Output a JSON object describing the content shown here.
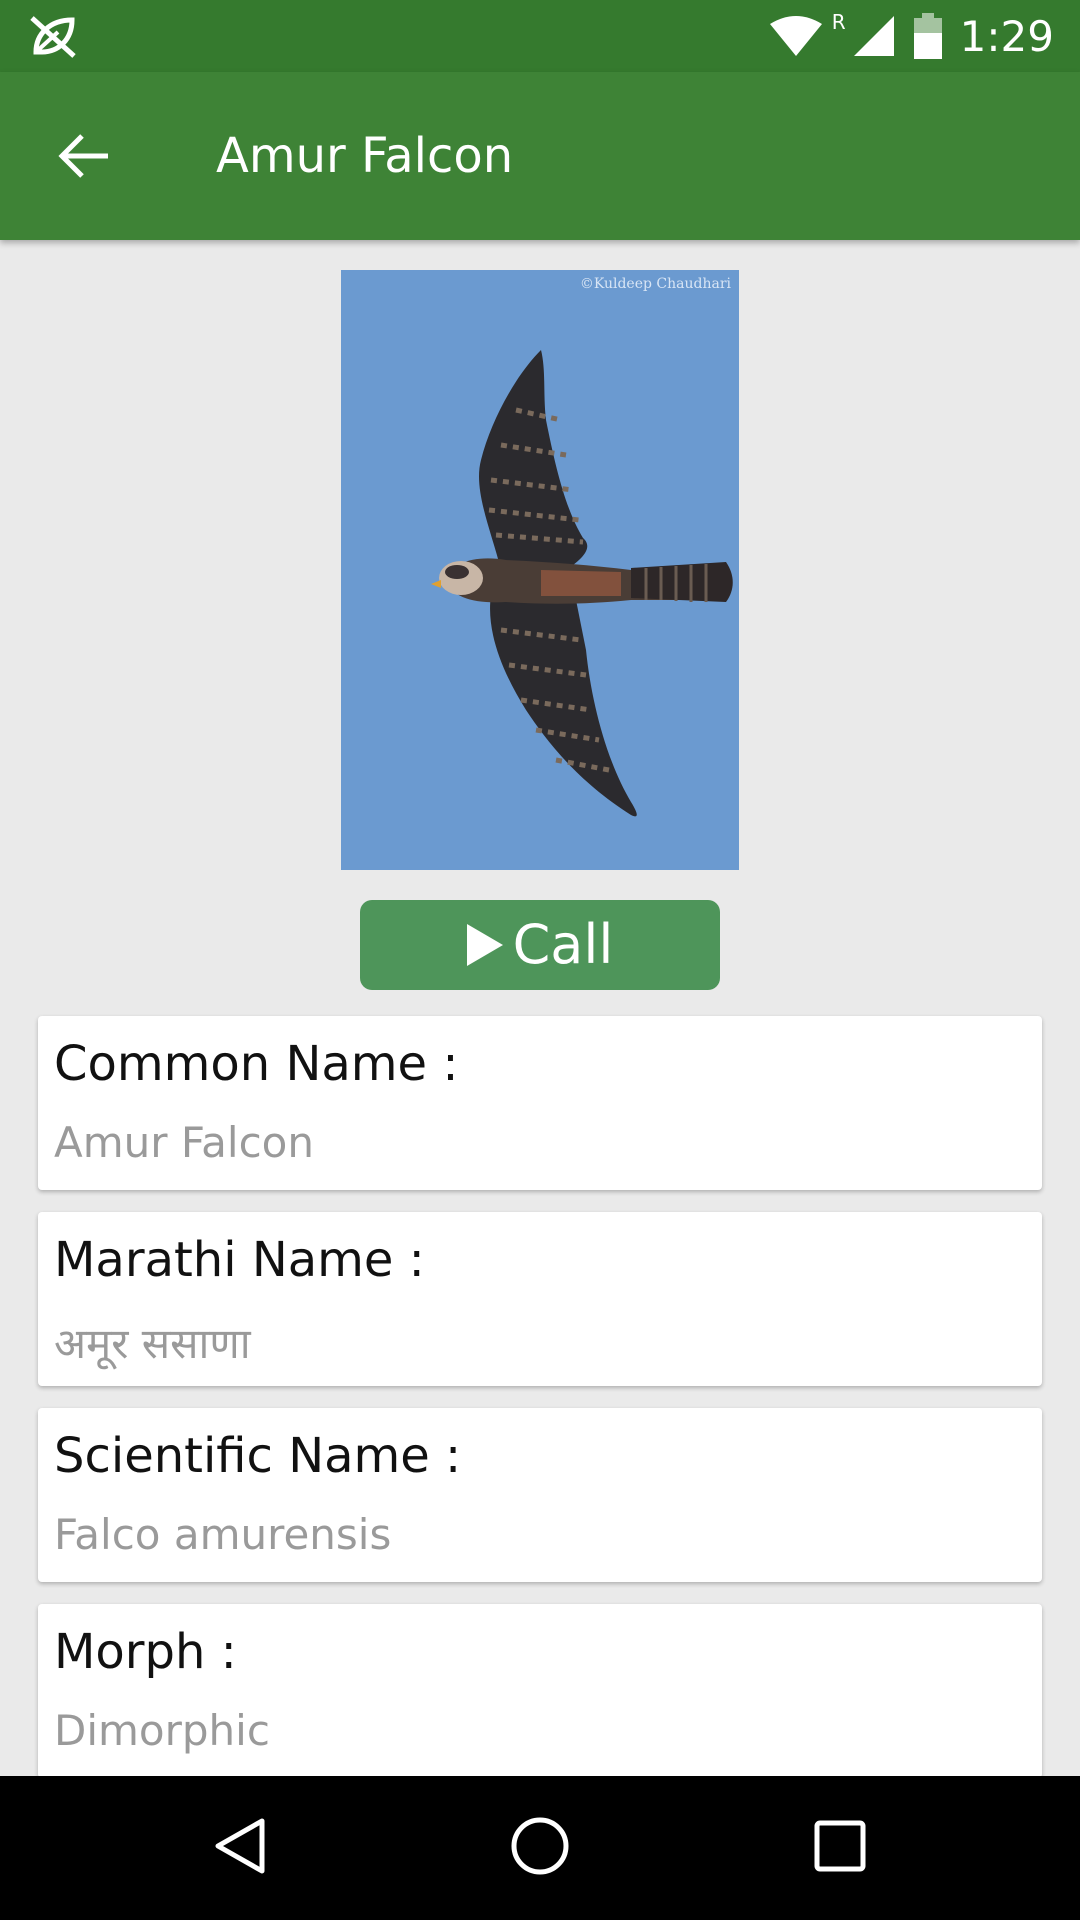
{
  "status_bar": {
    "time": "1:29",
    "left_icon": "no-sync-icon",
    "wifi_icon": "wifi-icon",
    "roaming_indicator": "R",
    "signal_icon": "cell-signal-icon",
    "battery_icon": "battery-icon"
  },
  "app_bar": {
    "title": "Amur Falcon",
    "back_icon": "arrow-back-icon"
  },
  "photo": {
    "subject": "Amur Falcon in flight",
    "credit": "©Kuldeep Chaudhari"
  },
  "call_button": {
    "label": "Call",
    "icon": "play-icon"
  },
  "details": [
    {
      "label": "Common Name :",
      "value": "Amur Falcon"
    },
    {
      "label": "Marathi Name :",
      "value": "अमूर ससाणा"
    },
    {
      "label": "Scientific Name :",
      "value": "Falco amurensis"
    },
    {
      "label": "Morph :",
      "value": "Dimorphic"
    }
  ],
  "nav_bar": {
    "back": "nav-back-icon",
    "home": "nav-home-icon",
    "recents": "nav-recents-icon"
  },
  "colors": {
    "status_bar": "#357a2e",
    "app_bar": "#3e8336",
    "call_button": "#4e955a",
    "background": "#eaeaea",
    "sky": "#6b9ad0"
  }
}
